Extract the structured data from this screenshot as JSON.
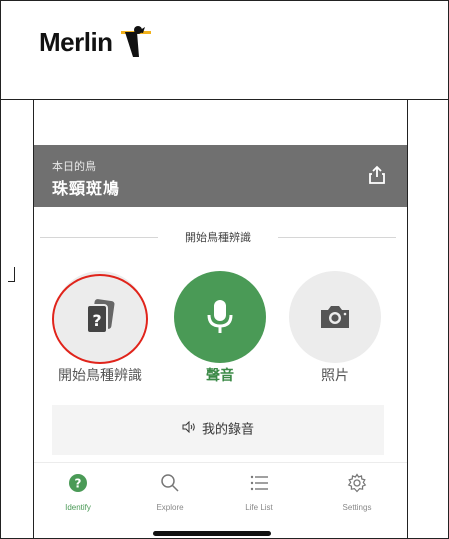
{
  "header": {
    "logo_text": "Merlin"
  },
  "bird_of_day": {
    "caption": "本日的鳥",
    "name": "珠頸斑鳩",
    "share_icon": "share-icon"
  },
  "identify": {
    "section_title": "開始鳥種辨識",
    "options": [
      {
        "label": "開始鳥種辨識",
        "icon": "cards-question-icon"
      },
      {
        "label": "聲音",
        "icon": "microphone-icon"
      },
      {
        "label": "照片",
        "icon": "camera-icon"
      }
    ],
    "recordings_label": "我的錄音"
  },
  "tabs": [
    {
      "label": "Identify",
      "icon": "question-badge-icon",
      "active": true
    },
    {
      "label": "Explore",
      "icon": "search-icon"
    },
    {
      "label": "Life List",
      "icon": "list-icon"
    },
    {
      "label": "Settings",
      "icon": "gear-icon"
    }
  ],
  "colors": {
    "accent_green": "#4a9a56",
    "banner_gray": "#707070",
    "highlight_red": "#e0241b"
  }
}
